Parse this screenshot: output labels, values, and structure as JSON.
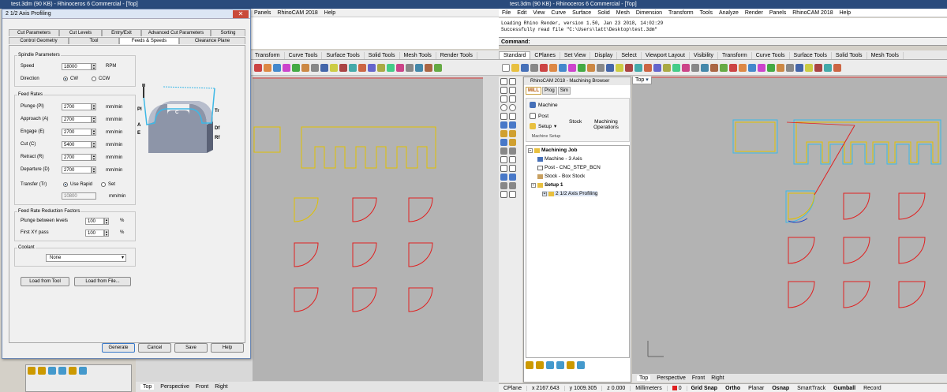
{
  "left_window": {
    "title": "test.3dm (90 KB) - Rhinoceros 6 Commercial - [Top]",
    "menu": [
      "Panels",
      "RhinoCAM 2018",
      "Help"
    ],
    "toolbar_tabs": [
      "Transform",
      "Curve Tools",
      "Surface Tools",
      "Solid Tools",
      "Mesh Tools",
      "Render Tools"
    ],
    "viewport_tabs": [
      "Top",
      "Perspective",
      "Front",
      "Right"
    ]
  },
  "dialog": {
    "title": "2 1/2 Axis Profiling",
    "close": "✕",
    "tabs_row1": [
      "Cut Parameters",
      "Cut Levels",
      "Entry/Exit",
      "Advanced Cut Parameters",
      "Sorting"
    ],
    "tabs_row2": [
      "Control Geometry",
      "Tool",
      "Feeds & Speeds",
      "Clearance Plane"
    ],
    "spindle": {
      "group": "Spindle Parameters",
      "speed_label": "Speed",
      "speed_value": "18000",
      "speed_unit": "RPM",
      "direction_label": "Direction",
      "cw": "CW",
      "ccw": "CCW"
    },
    "feed": {
      "group": "Feed Rates",
      "rows": [
        {
          "label": "Plunge (Pl)",
          "value": "2700",
          "unit": "mm/min"
        },
        {
          "label": "Approach (A)",
          "value": "2700",
          "unit": "mm/min"
        },
        {
          "label": "Engage (E)",
          "value": "2700",
          "unit": "mm/min"
        },
        {
          "label": "Cut (C)",
          "value": "5400",
          "unit": "mm/min"
        },
        {
          "label": "Retract (R)",
          "value": "2700",
          "unit": "mm/min"
        },
        {
          "label": "Departure (D)",
          "value": "2700",
          "unit": "mm/min"
        }
      ],
      "transfer_label": "Transfer (Tr)",
      "use_rapid": "Use Rapid",
      "set": "Set",
      "transfer_value": "10800",
      "transfer_unit": "mm/min",
      "diagram_labels": {
        "pl": "Pl",
        "a": "A",
        "e": "E",
        "c": "C",
        "tr": "Tr",
        "df": "Df",
        "rf": "Rf"
      }
    },
    "reduction": {
      "group": "Feed Rate Reduction Factors",
      "plunge_label": "Plunge between levels",
      "plunge_value": "100",
      "first_label": "First XY pass",
      "first_value": "100",
      "percent": "%"
    },
    "coolant": {
      "label": "Coolant",
      "value": "None"
    },
    "load_tool": "Load from Tool",
    "load_file": "Load from File...",
    "buttons": {
      "generate": "Generate",
      "cancel": "Cancel",
      "save": "Save",
      "help": "Help"
    }
  },
  "right_window": {
    "title": "test.3dm (90 KB) - Rhinoceros 6 Commercial - [Top]",
    "menu": [
      "File",
      "Edit",
      "View",
      "Curve",
      "Surface",
      "Solid",
      "Mesh",
      "Dimension",
      "Transform",
      "Tools",
      "Analyze",
      "Render",
      "Panels",
      "RhinoCAM 2018",
      "Help"
    ],
    "command_history": [
      "Loading Rhino Render, version 1.50, Jan 23 2018, 14:02:29",
      "Successfully read file \"C:\\Users\\latt\\Desktop\\test.3dm\""
    ],
    "command_label": "Command:",
    "toolbar_tabs": [
      "Standard",
      "CPlanes",
      "Set View",
      "Display",
      "Select",
      "Viewport Layout",
      "Visibility",
      "Transform",
      "Curve Tools",
      "Surface Tools",
      "Solid Tools",
      "Mesh Tools"
    ],
    "viewport_tab": "Top",
    "viewport_tabs": [
      "Top",
      "Perspective",
      "Front",
      "Right"
    ],
    "status": {
      "cplane": "CPlane",
      "x": "x 2167.643",
      "y": "y 1009.305",
      "z": "z 0.000",
      "units": "Millimeters",
      "layer": "0",
      "toggles": [
        "Grid Snap",
        "Ortho",
        "Planar",
        "Osnap",
        "SmartTrack",
        "Gumball",
        "Record"
      ]
    }
  },
  "browser": {
    "title": "RhinoCAM 2018 - Machining Browser",
    "tabs": [
      "MILL",
      "Prog",
      "Sim"
    ],
    "machine": "Machine",
    "post": "Post",
    "setup": "Setup",
    "stock": "Stock",
    "machining_ops": "Machining Operations",
    "machine_setup": "Machine Setup",
    "tree": {
      "job": "Machining Job",
      "machine": "Machine - 3 Axis",
      "post": "Post - CNC_STEP_BCN",
      "stock": "Stock - Box Stock",
      "setup": "Setup 1",
      "op": "2 1/2 Axis Profiling"
    }
  },
  "colors": {
    "geometry": "#e0c000",
    "quarter": "#e02020",
    "toolpath": "#3db8e6",
    "viewport": "#b3b3b3"
  }
}
